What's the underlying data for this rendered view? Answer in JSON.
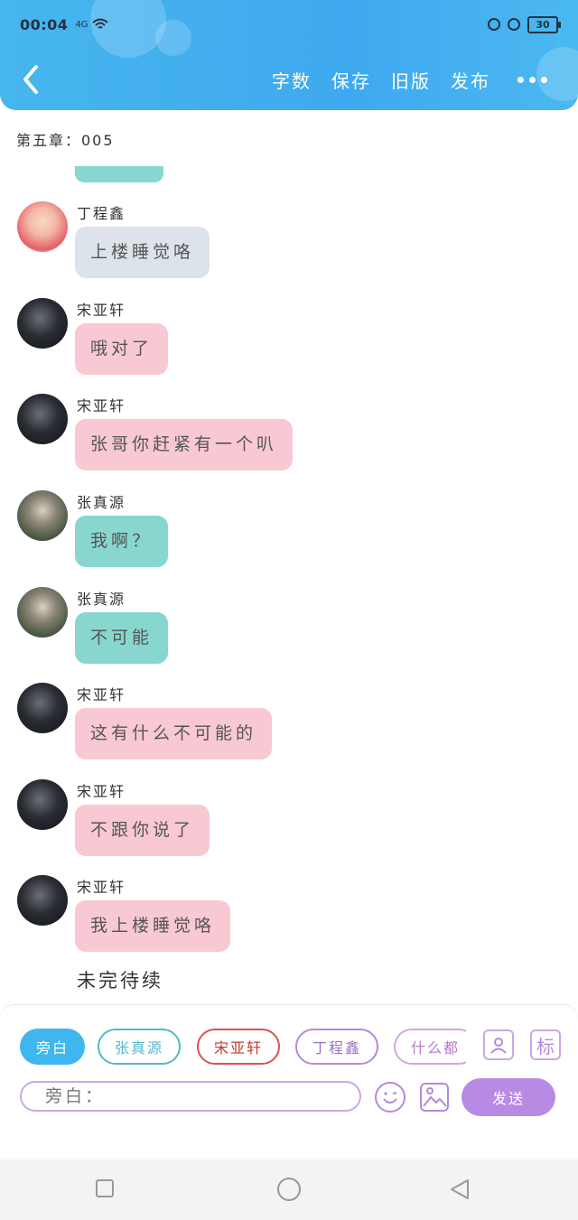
{
  "status_bar": {
    "time": "00:04",
    "signal": "4G",
    "battery": "30"
  },
  "header": {
    "menu": [
      "字数",
      "保存",
      "旧版",
      "发布"
    ],
    "accent": "#47b6ee"
  },
  "chapter_title": "第五章：005",
  "messages": [
    {
      "name": "丁程鑫",
      "text": "上楼睡觉咯",
      "color": "gray"
    },
    {
      "name": "宋亚轩",
      "text": "哦对了",
      "color": "pink"
    },
    {
      "name": "宋亚轩",
      "text": "张哥你赶紧有一个叭",
      "color": "pink"
    },
    {
      "name": "张真源",
      "text": "我啊？",
      "color": "teal"
    },
    {
      "name": "张真源",
      "text": "不可能",
      "color": "teal"
    },
    {
      "name": "宋亚轩",
      "text": "这有什么不可能的",
      "color": "pink"
    },
    {
      "name": "宋亚轩",
      "text": "不跟你说了",
      "color": "pink"
    },
    {
      "name": "宋亚轩",
      "text": "我上楼睡觉咯",
      "color": "pink"
    }
  ],
  "to_be_continued": "未完待续",
  "role_chips": [
    "旁白",
    "张真源",
    "宋亚轩",
    "丁程鑫",
    "什么都"
  ],
  "tag_icon_label": "标",
  "input": {
    "placeholder": "旁白："
  },
  "send_label": "发送"
}
